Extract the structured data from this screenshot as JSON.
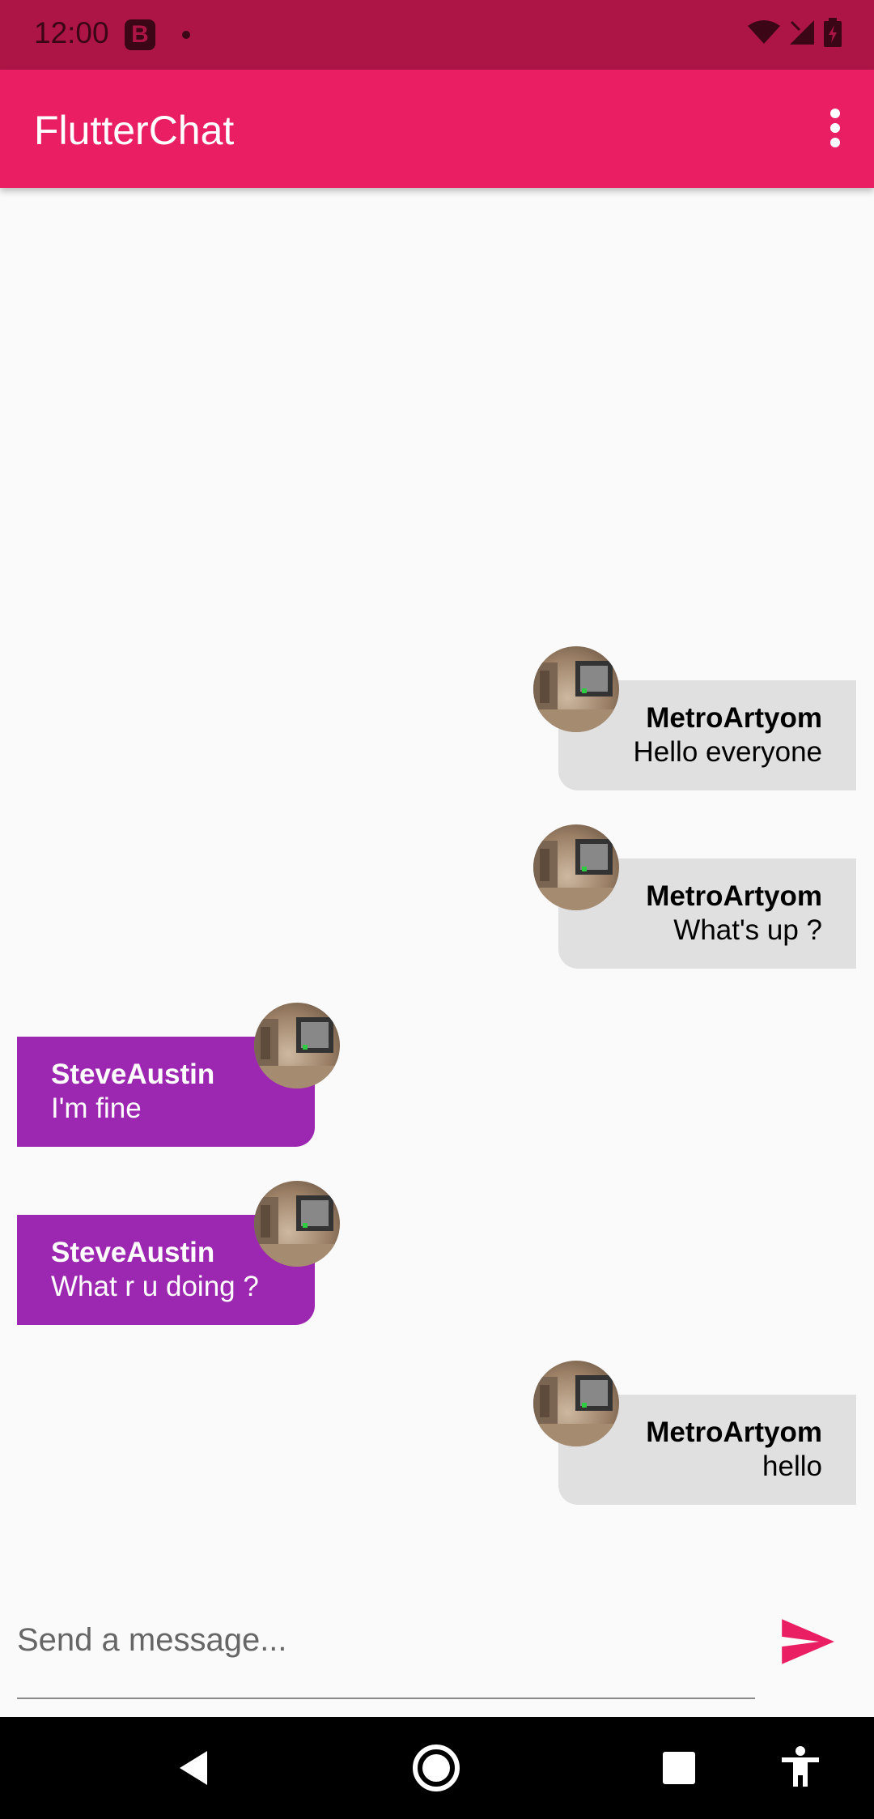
{
  "status_bar": {
    "time": "12:00",
    "notification_badge": "B"
  },
  "app_bar": {
    "title": "FlutterChat",
    "menu_icon": "more-vert-icon"
  },
  "messages": [
    {
      "sender": "MetroArtyom",
      "text": "Hello everyone",
      "is_me": true
    },
    {
      "sender": "MetroArtyom",
      "text": "What's up ?",
      "is_me": true
    },
    {
      "sender": "SteveAustin",
      "text": "I'm fine",
      "is_me": false
    },
    {
      "sender": "SteveAustin",
      "text": "What r u doing ?",
      "is_me": false
    },
    {
      "sender": "MetroArtyom",
      "text": "hello",
      "is_me": true
    }
  ],
  "composer": {
    "placeholder": "Send a message...",
    "send_icon": "send-icon"
  },
  "colors": {
    "status_bar": "#ad1547",
    "app_bar": "#e91e63",
    "my_bubble": "#e0e0e0",
    "other_bubble": "#9c27b0",
    "send_icon": "#e91e63"
  },
  "nav_bar": {
    "icons": [
      "back-icon",
      "home-icon",
      "recents-icon",
      "accessibility-icon"
    ]
  }
}
